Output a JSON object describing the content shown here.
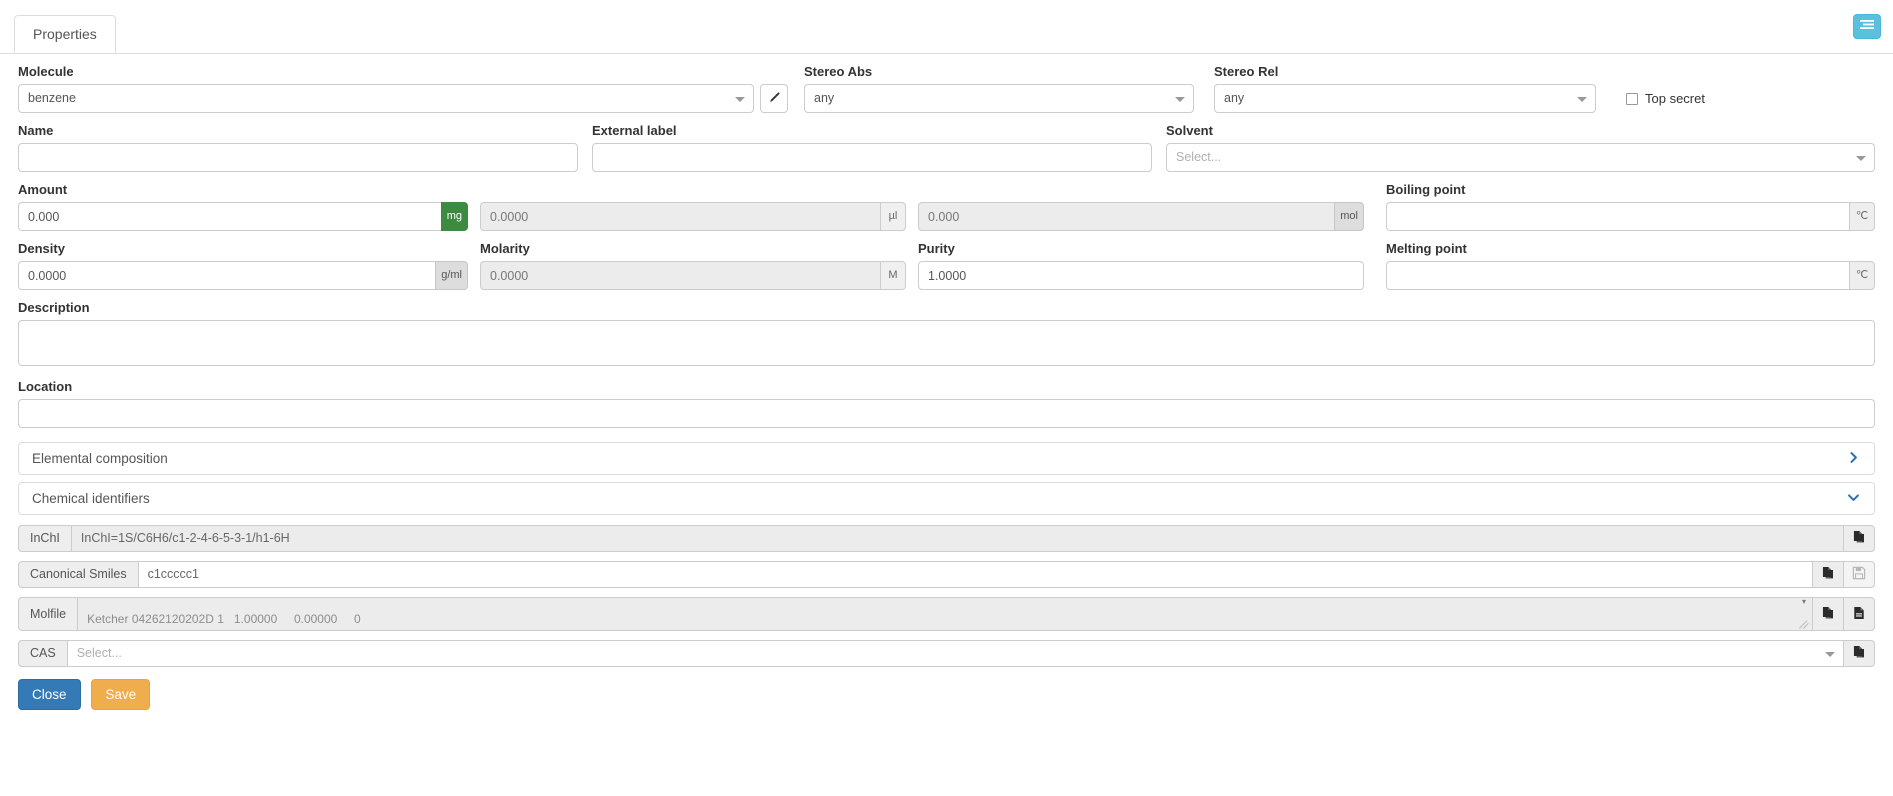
{
  "window": {
    "tab_label": "Properties",
    "panel_toggle_icon": "list-icon"
  },
  "form": {
    "molecule": {
      "label": "Molecule",
      "value": "benzene",
      "edit_icon": "pencil-icon"
    },
    "stereo_abs": {
      "label": "Stereo Abs",
      "value": "any"
    },
    "stereo_rel": {
      "label": "Stereo Rel",
      "value": "any"
    },
    "top_secret": {
      "label": "Top secret",
      "checked": false
    },
    "name": {
      "label": "Name",
      "value": "",
      "placeholder": ""
    },
    "external_label": {
      "label": "External label",
      "value": "",
      "placeholder": ""
    },
    "solvent": {
      "label": "Solvent",
      "value": "",
      "placeholder": "Select..."
    },
    "amount": {
      "label": "Amount",
      "mass_value": "0.000",
      "mass_unit": "mg",
      "volume_value": "0.0000",
      "volume_unit": "µl",
      "mol_value": "0.000",
      "mol_unit": "mol"
    },
    "boiling_point": {
      "label": "Boiling point",
      "value": "",
      "unit": "℃"
    },
    "density": {
      "label": "Density",
      "value": "0.0000",
      "unit": "g/ml"
    },
    "molarity": {
      "label": "Molarity",
      "value": "0.0000",
      "unit": "M"
    },
    "purity": {
      "label": "Purity",
      "value": "1.0000"
    },
    "melting_point": {
      "label": "Melting point",
      "value": "",
      "unit": "℃"
    },
    "description": {
      "label": "Description",
      "value": "",
      "placeholder": ""
    },
    "location": {
      "label": "Location",
      "value": "",
      "placeholder": ""
    }
  },
  "sections": {
    "elemental_composition": {
      "title": "Elemental composition",
      "state": "collapsed",
      "chevron": "chevron-right-icon"
    },
    "chemical_identifiers": {
      "title": "Chemical identifiers",
      "state": "expanded",
      "chevron": "chevron-down-icon"
    }
  },
  "identifiers": {
    "inchi": {
      "tag": "InChI",
      "value": "InChI=1S/C6H6/c1-2-4-6-5-3-1/h1-6H",
      "copy_icon": "copy-icon"
    },
    "canonical_smiles": {
      "tag": "Canonical Smiles",
      "value": "c1ccccc1",
      "copy_icon": "copy-icon",
      "save_icon": "floppy-disk-icon"
    },
    "molfile": {
      "tag": "Molfile",
      "value": "Ketcher 04262120202D 1   1.00000     0.00000     0",
      "copy_icon": "copy-icon",
      "file_icon": "file-text-icon"
    },
    "cas": {
      "tag": "CAS",
      "value": "",
      "placeholder": "Select...",
      "copy_icon": "copy-icon"
    }
  },
  "footer": {
    "close_label": "Close",
    "save_label": "Save"
  },
  "colors": {
    "primary": "#337ab7",
    "warning": "#f0ad4e",
    "info": "#5bc0de",
    "success": "#3d8b40",
    "chevron": "#2b6faf"
  }
}
